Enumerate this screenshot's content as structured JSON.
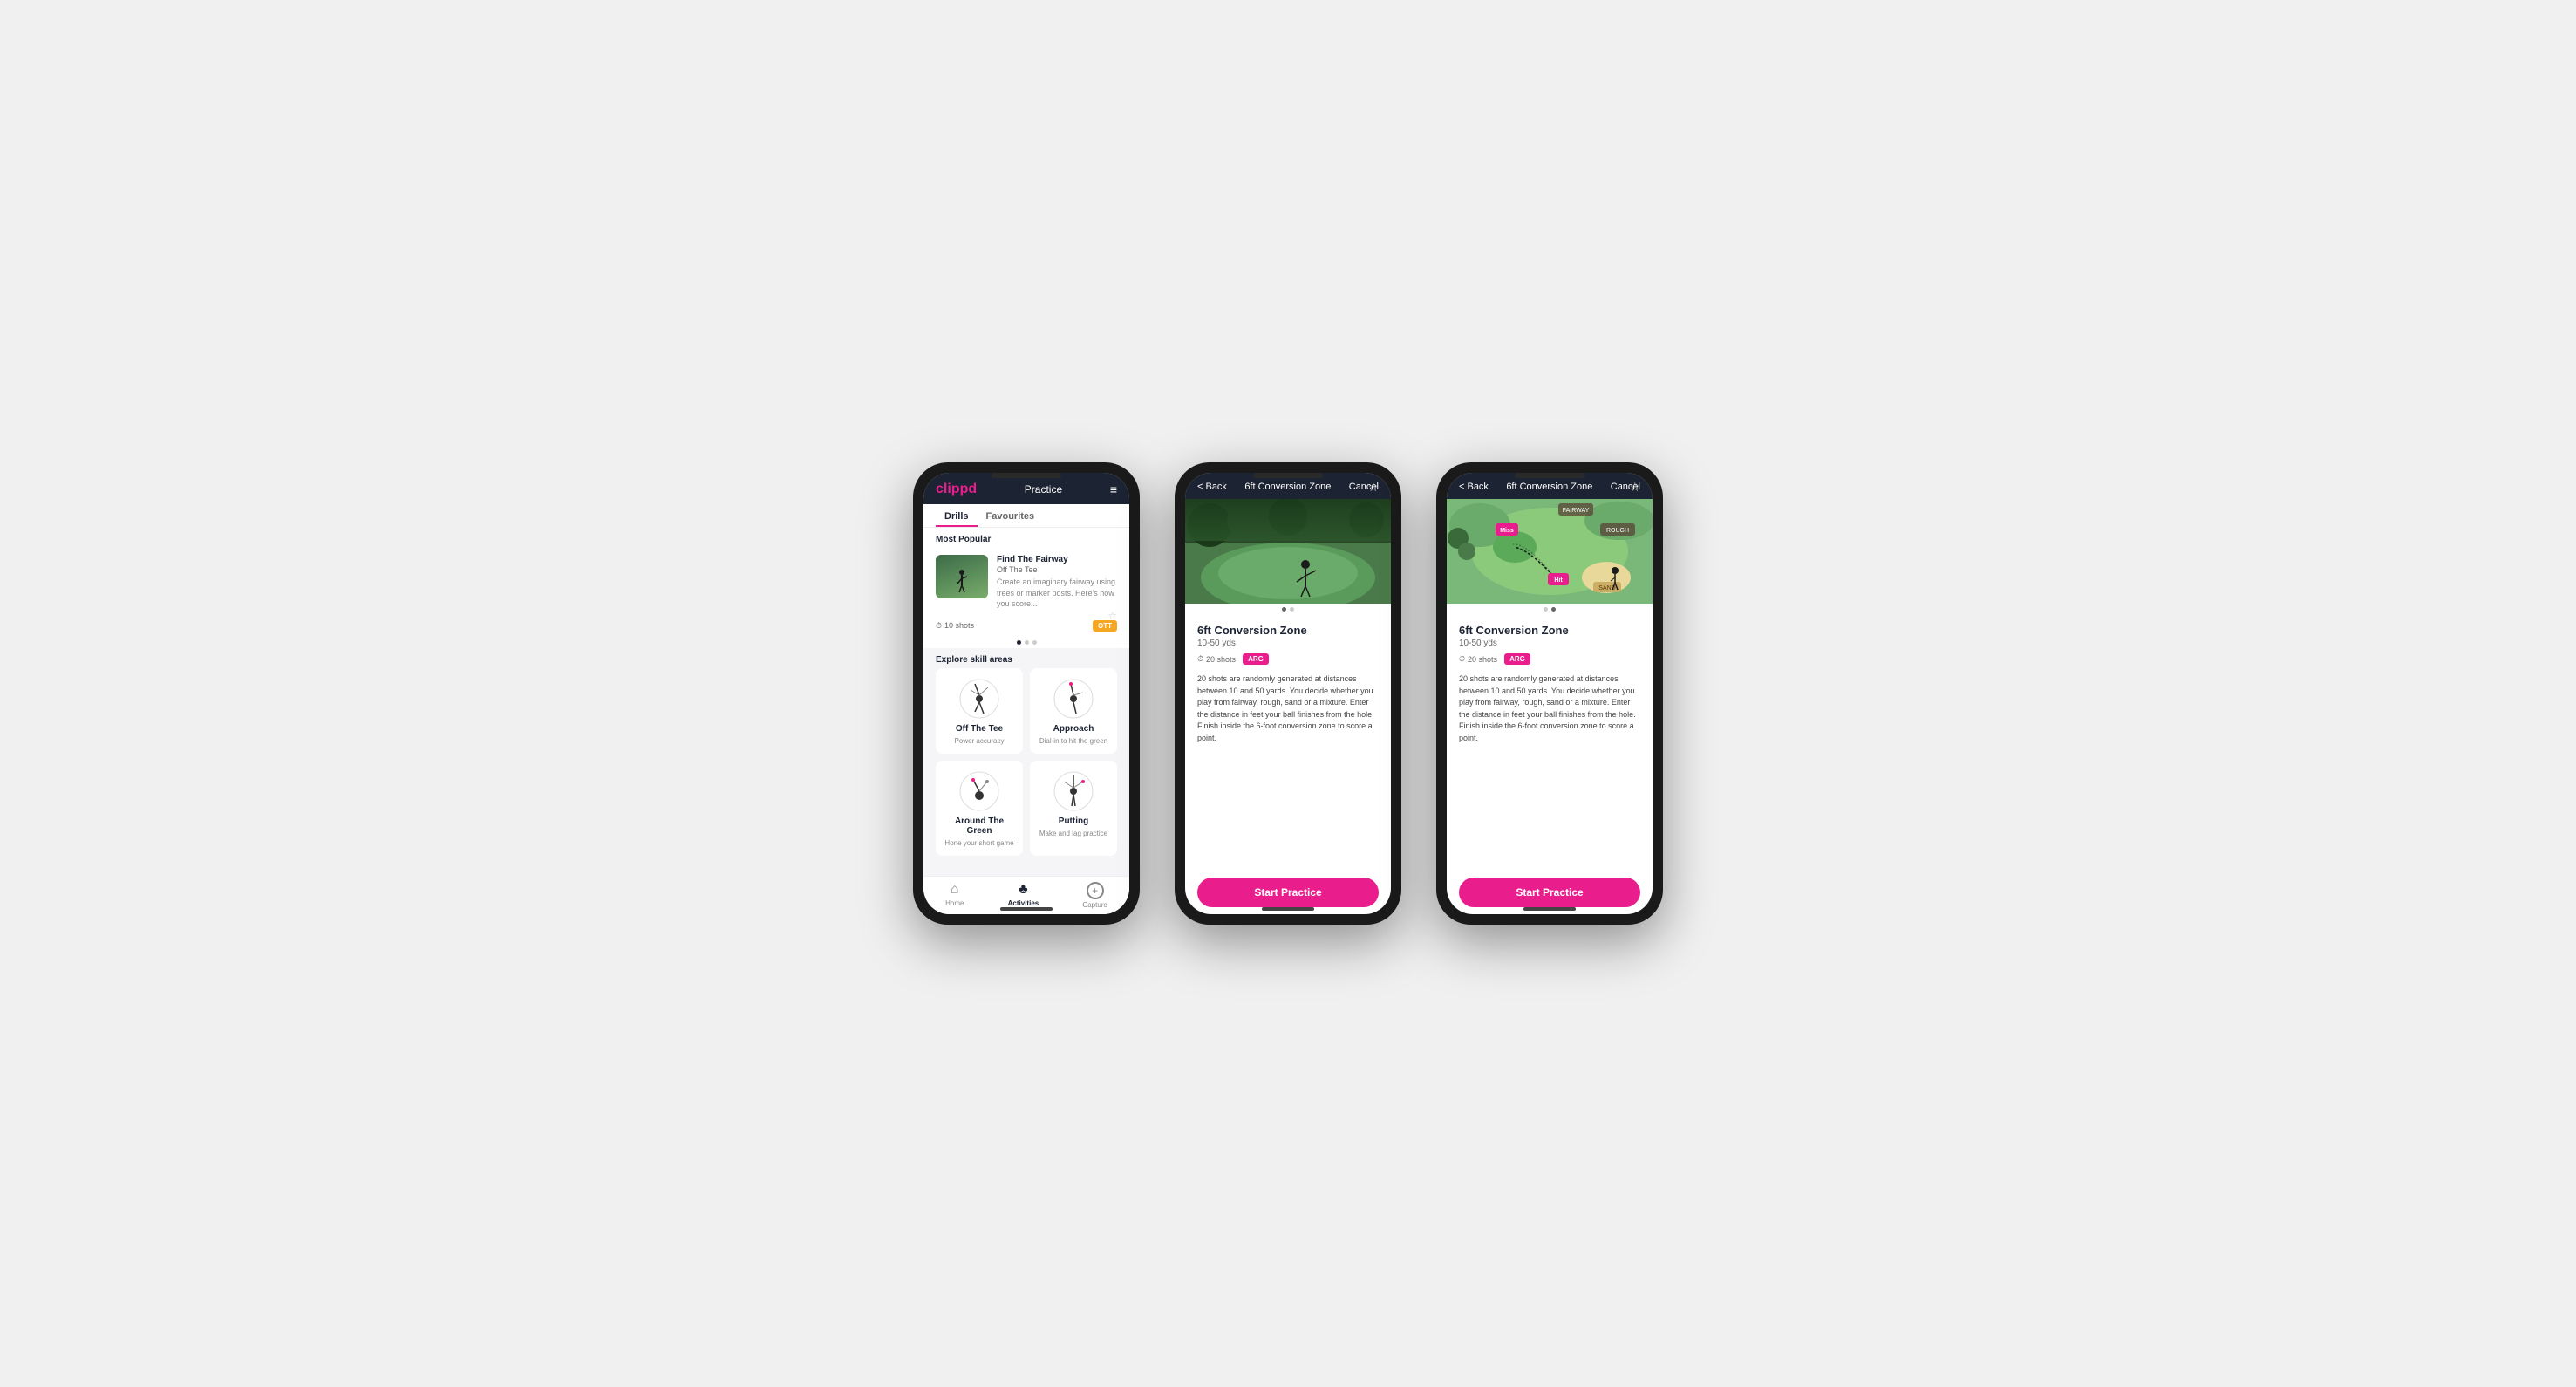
{
  "phone1": {
    "header": {
      "logo": "clippd",
      "title": "Practice",
      "menu_icon": "≡"
    },
    "tabs": [
      {
        "label": "Drills",
        "active": true
      },
      {
        "label": "Favourites",
        "active": false
      }
    ],
    "most_popular_label": "Most Popular",
    "featured_drill": {
      "title": "Find The Fairway",
      "subtitle": "Off The Tee",
      "description": "Create an imaginary fairway using trees or marker posts. Here's how you score...",
      "shots": "10 shots",
      "badge": "OTT"
    },
    "explore_label": "Explore skill areas",
    "skills": [
      {
        "name": "Off The Tee",
        "desc": "Power accuracy"
      },
      {
        "name": "Approach",
        "desc": "Dial-in to hit the green"
      },
      {
        "name": "Around The Green",
        "desc": "Hone your short game"
      },
      {
        "name": "Putting",
        "desc": "Make and lag practice"
      }
    ],
    "bottom_nav": [
      {
        "label": "Home",
        "icon": "⌂",
        "active": false
      },
      {
        "label": "Activities",
        "icon": "♣",
        "active": true
      },
      {
        "label": "Capture",
        "icon": "+",
        "active": false
      }
    ]
  },
  "phone2": {
    "header": {
      "back_label": "< Back",
      "title": "6ft Conversion Zone",
      "cancel_label": "Cancel"
    },
    "drill": {
      "title": "6ft Conversion Zone",
      "range": "10-50 yds",
      "shots": "20 shots",
      "badge": "ARG",
      "description": "20 shots are randomly generated at distances between 10 and 50 yards. You decide whether you play from fairway, rough, sand or a mixture. Enter the distance in feet your ball finishes from the hole. Finish inside the 6-foot conversion zone to score a point.",
      "start_button": "Start Practice"
    },
    "image_type": "photo"
  },
  "phone3": {
    "header": {
      "back_label": "< Back",
      "title": "6ft Conversion Zone",
      "cancel_label": "Cancel"
    },
    "drill": {
      "title": "6ft Conversion Zone",
      "range": "10-50 yds",
      "shots": "20 shots",
      "badge": "ARG",
      "description": "20 shots are randomly generated at distances between 10 and 50 yards. You decide whether you play from fairway, rough, sand or a mixture. Enter the distance in feet your ball finishes from the hole. Finish inside the 6-foot conversion zone to score a point.",
      "start_button": "Start Practice"
    },
    "image_type": "map"
  }
}
